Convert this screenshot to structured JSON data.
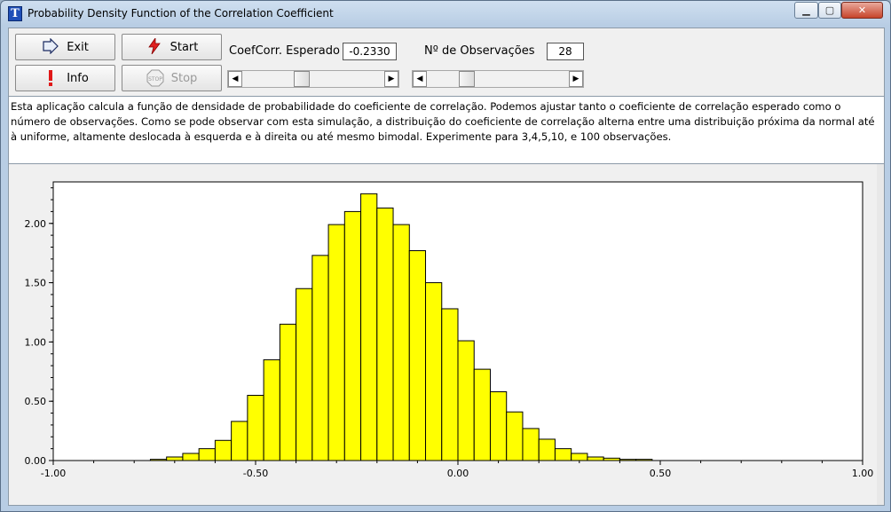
{
  "window": {
    "title": "Probability Density Function of the Correlation Coefficient",
    "app_icon_text": "T"
  },
  "buttons": {
    "exit_label": "Exit",
    "start_label": "Start",
    "info_label": "Info",
    "stop_label": "Stop"
  },
  "controls": {
    "coefcorr_label": "CoefCorr. Esperado",
    "coefcorr_value": "-0.2330",
    "observations_label": "Nº de Observações",
    "observations_value": "28"
  },
  "description": "Esta aplicação calcula a função de densidade de probabilidade do coeficiente de correlação.  Podemos ajustar tanto o coeficiente de correlação esperado como o número de observações. Como se pode observar com esta simulação, a distribuição do coeficiente de correlação alterna entre uma distribuição próxima da normal até à uniforme, altamente deslocada à esquerda e à direita ou até mesmo bimodal. Experimente para 3,4,5,10, e 100 observações.",
  "colors": {
    "bar_fill": "#ffff00",
    "bar_stroke": "#000000"
  },
  "chart_data": {
    "type": "bar",
    "title": "",
    "xlabel": "",
    "ylabel": "",
    "xlim": [
      -1.0,
      1.0
    ],
    "ylim": [
      0,
      2.35
    ],
    "x_ticks": [
      "-1.00",
      "-0.50",
      "0.00",
      "0.50",
      "1.00"
    ],
    "y_ticks": [
      "0.00",
      "0.50",
      "1.00",
      "1.50",
      "2.00"
    ],
    "bin_width": 0.04,
    "bin_lefts": [
      -0.76,
      -0.72,
      -0.68,
      -0.64,
      -0.6,
      -0.56,
      -0.52,
      -0.48,
      -0.44,
      -0.4,
      -0.36,
      -0.32,
      -0.28,
      -0.24,
      -0.2,
      -0.16,
      -0.12,
      -0.08,
      -0.04,
      0.0,
      0.04,
      0.08,
      0.12,
      0.16,
      0.2,
      0.24,
      0.28,
      0.32,
      0.36,
      0.4,
      0.44
    ],
    "values": [
      0.01,
      0.03,
      0.06,
      0.1,
      0.17,
      0.33,
      0.55,
      0.85,
      1.15,
      1.45,
      1.73,
      1.99,
      2.1,
      2.25,
      2.13,
      1.99,
      1.77,
      1.5,
      1.28,
      1.01,
      0.77,
      0.58,
      0.41,
      0.27,
      0.18,
      0.1,
      0.06,
      0.03,
      0.02,
      0.01,
      0.01
    ],
    "grid": false
  }
}
